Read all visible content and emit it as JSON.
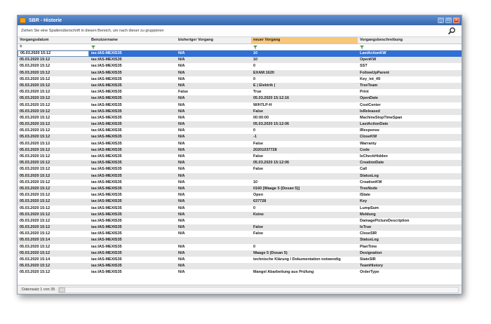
{
  "window": {
    "title": "SBR - Historie"
  },
  "group_hint": "Ziehen Sie eine Spaltenüberschrift in diesen Bereich, um nach dieser zu gruppieren",
  "columns": [
    "Vorgangsdatum",
    "Benutzername",
    "bisheriger Vorgang",
    "neuer Vorgang",
    "Vorgangsbeschreibung"
  ],
  "sorted_column": "neuer Vorgang",
  "filter_first": "=",
  "colors": {
    "selection": "#2f6fd6",
    "sorted_header": "#f9c77a",
    "titlebar": "#3766ad"
  },
  "rows": [
    [
      "05.03.2020 15:12",
      "ias:IAS-MEXIS35",
      "N/A",
      "10",
      "LastActionKW"
    ],
    [
      "05.03.2020 15:12",
      "ias:IAS-MEXIS35",
      "N/A",
      "10",
      "OpenKW"
    ],
    [
      "05.03.2020 15:12",
      "ias:IAS-MEXIS35",
      "N/A",
      "0",
      "SST"
    ],
    [
      "05.03.2020 15:12",
      "ias:IAS-MEXIS35",
      "N/A",
      "EXAM:1620",
      "FollowUpParent"
    ],
    [
      "05.03.2020 15:12",
      "ias:IAS-MEXIS35",
      "N/A",
      "0",
      "Key_int_49"
    ],
    [
      "05.03.2020 15:12",
      "ias:IAS-MEXIS35",
      "N/A",
      "E | Elektrik |",
      "TreeTeam"
    ],
    [
      "05.03.2020 15:12",
      "ias:IAS-MEXIS35",
      "False",
      "True",
      "Print"
    ],
    [
      "05.03.2020 15:12",
      "ias:IAS-MEXIS35",
      "N/A",
      "05.03.2020 15:12:16",
      "OpenDate"
    ],
    [
      "05.03.2020 15:12",
      "ias:IAS-MEXIS35",
      "N/A",
      "W/H7LP-H",
      "CostCenter"
    ],
    [
      "05.03.2020 15:12",
      "ias:IAS-MEXIS35",
      "N/A",
      "False",
      "IsReleased"
    ],
    [
      "05.03.2020 15:12",
      "ias:IAS-MEXIS35",
      "N/A",
      "00:00:00",
      "MachineStopTimeSpan"
    ],
    [
      "05.03.2020 15:12",
      "ias:IAS-MEXIS35",
      "N/A",
      "05.03.2020 15:12:06",
      "LastActionDate"
    ],
    [
      "05.03.2020 15:12",
      "ias:IAS-MEXIS35",
      "N/A",
      "0",
      "IResponse"
    ],
    [
      "05.03.2020 15:12",
      "ias:IAS-MEXIS35",
      "N/A",
      "-1",
      "CloseKW"
    ],
    [
      "05.03.2020 15:12",
      "ias:IAS-MEXIS35",
      "N/A",
      "False",
      "Warranty"
    ],
    [
      "05.03.2020 15:12",
      "ias:IAS-MEXIS35",
      "N/A",
      "20201037728",
      "Code"
    ],
    [
      "05.03.2020 15:12",
      "ias:IAS-MEXIS35",
      "N/A",
      "False",
      "IsCheckHidden"
    ],
    [
      "05.03.2020 15:12",
      "ias:IAS-MEXIS35",
      "N/A",
      "05.03.2020 15:12:06",
      "CreationDate"
    ],
    [
      "05.03.2020 15:12",
      "ias:IAS-MEXIS35",
      "N/A",
      "False",
      "Call"
    ],
    [
      "05.03.2020 15:12",
      "ias:IAS-MEXIS35",
      "N/A",
      "",
      "StatusLog"
    ],
    [
      "05.03.2020 15:12",
      "ias:IAS-MEXIS35",
      "N/A",
      "10",
      "CreationKW"
    ],
    [
      "05.03.2020 15:12",
      "ias:IAS-MEXIS35",
      "N/A",
      "0160 [Waage 5 (Dosan 5)]",
      "TreeNode"
    ],
    [
      "05.03.2020 15:12",
      "ias:IAS-MEXIS35",
      "N/A",
      "Open",
      "IState"
    ],
    [
      "05.03.2020 15:12",
      "ias:IAS-MEXIS35",
      "N/A",
      "637728",
      "Key"
    ],
    [
      "05.03.2020 15:12",
      "ias:IAS-MEXIS35",
      "N/A",
      "0",
      "LumpSum"
    ],
    [
      "05.03.2020 15:12",
      "ias:IAS-MEXIS35",
      "N/A",
      "Keine",
      "Meldung"
    ],
    [
      "05.03.2020 15:12",
      "ias:IAS-MEXIS35",
      "N/A",
      "",
      "DamagePictureDescription"
    ],
    [
      "05.03.2020 15:12",
      "ias:IAS-MEXIS35",
      "N/A",
      "False",
      "IsTrue"
    ],
    [
      "05.03.2020 15:12",
      "ias:IAS-MEXIS35",
      "N/A",
      "False",
      "CloseSIR"
    ],
    [
      "05.03.2020 15:14",
      "ias:IAS-MEXIS35",
      "",
      "",
      "StatusLog"
    ],
    [
      "05.03.2020 15:12",
      "ias:IAS-MEXIS35",
      "N/A",
      "0",
      "PlanTime"
    ],
    [
      "05.03.2020 15:12",
      "ias:IAS-MEXIS35",
      "N/A",
      "Waage 5 (Dosan 5)",
      "Designation"
    ],
    [
      "05.03.2020 15:14",
      "ias:IAS-MEXIS35",
      "N/A",
      "technische Klärung / Dokumentation notwendig",
      "StateSIR"
    ],
    [
      "05.03.2020 15:12",
      "ias:IAS-MEXIS35",
      "N/A",
      "",
      "TeamHistory"
    ],
    [
      "05.03.2020 15:12",
      "ias:IAS-MEXIS35",
      "N/A",
      "Mangel Abarbeitung aus Prüfung",
      "OrderType"
    ]
  ],
  "status": "Datensatz 1 von 35"
}
